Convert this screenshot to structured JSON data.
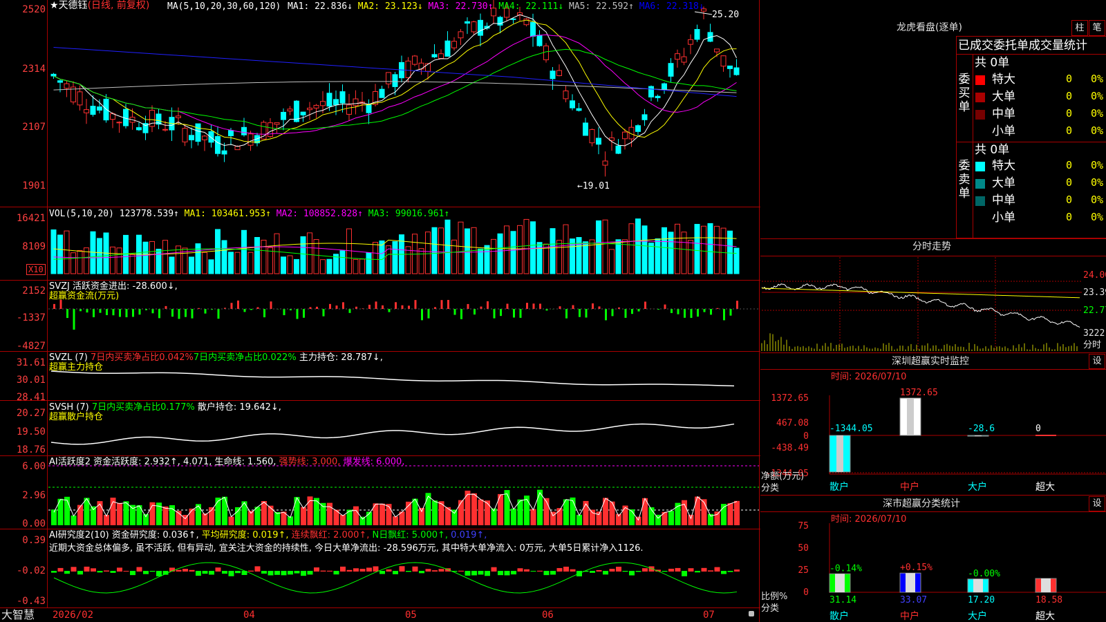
{
  "main": {
    "title_star": "★",
    "stock_name": "天德钰",
    "period": "(日线, 前复权)",
    "ma_params": "MA(5,10,20,30,60,120)",
    "ma_values": [
      {
        "label": "MA1: 22.836↓",
        "color": "#ffffff"
      },
      {
        "label": "MA2: 23.123↓",
        "color": "#ffff00"
      },
      {
        "label": "MA3: 22.730↑",
        "color": "#ff00ff"
      },
      {
        "label": "MA4: 22.111↓",
        "color": "#00ff00"
      },
      {
        "label": "MA5: 22.592↑",
        "color": "#c0c0c0"
      },
      {
        "label": "MA6: 22.318↓",
        "color": "#0000ff"
      }
    ],
    "y_axis": [
      "2520",
      "2314",
      "2107",
      "1901"
    ],
    "high_marker": "25.20",
    "low_marker": "←19.01"
  },
  "vol": {
    "label": "VOL(5,10,20)",
    "value": "123778.539↑",
    "ma1": "MA1: 103461.953↑",
    "ma2": "MA2: 108852.828↑",
    "ma3": "MA3: 99016.961↑",
    "y_axis": [
      "16421",
      "8109"
    ],
    "unit": "X10"
  },
  "svzj": {
    "label": "SVZJ",
    "text": "活跃资金进出: -28.600↓,",
    "subtitle": "超赢资金流(万元)",
    "y_axis": [
      "2152",
      "-1337",
      "-4827"
    ]
  },
  "svzl": {
    "label": "SVZL (7)",
    "a": "7日内买卖净占比0.042%",
    "b": "7日内买卖净占比0.022%",
    "c": "主力持仓: 28.787↓,",
    "subtitle": "超赢主力持仓",
    "y_axis": [
      "31.61",
      "30.01",
      "28.41"
    ]
  },
  "svsh": {
    "label": "SVSH (7)",
    "a": "7日内买卖净占比0.177%",
    "b": "散户持仓: 19.642↓,",
    "subtitle": "超赢散户持仓",
    "y_axis": [
      "20.27",
      "19.50",
      "18.76"
    ]
  },
  "ai1": {
    "label": "AI活跃度2",
    "a": "资金活跃度: 2.932↑,",
    "b": "4.071,",
    "c": "生命线: 1.560,",
    "d": "强势线: 3.000,",
    "e": "爆发线: 6.000,",
    "y_axis": [
      "6.00",
      "2.96",
      "0.00"
    ]
  },
  "ai2": {
    "label": "AI研究度2(10)",
    "a": "资金研究度: 0.036↑,",
    "b": "平均研究度: 0.019↑,",
    "c": "连续飘红: 2.000↑,",
    "d": "N日飘红: 5.000↑,",
    "e": "0.019↑,",
    "comment": "近期大资金总体偏多, 虽不活跃, 但有异动, 宜关注大资金的持续性, 今日大单净流出: -28.596万元, 其中特大单净流入: 0万元, 大单5日累计净入1126.",
    "y_axis": [
      "0.39",
      "-0.02",
      "-0.43"
    ]
  },
  "xaxis": {
    "brand": "大智慧",
    "labels": [
      "2026/02",
      "04",
      "05",
      "06",
      "07"
    ]
  },
  "right": {
    "longhu_title": "龙虎看盘(逐单)",
    "btn_bar": "柱",
    "btn_pen": "笔",
    "tabs": "已成交委托单成交量统计",
    "buy": {
      "side_label": "委买单",
      "total": "共 0单",
      "rows": [
        {
          "name": "特大",
          "color": "#ff0000",
          "v": "0",
          "p": "0%"
        },
        {
          "name": "大单",
          "color": "#aa0000",
          "v": "0",
          "p": "0%"
        },
        {
          "name": "中单",
          "color": "#770000",
          "v": "0",
          "p": "0%"
        },
        {
          "name": "小单",
          "color": "#000000",
          "v": "0",
          "p": "0%"
        }
      ]
    },
    "sell": {
      "side_label": "委卖单",
      "total": "共 0单",
      "rows": [
        {
          "name": "特大",
          "color": "#00ffff",
          "v": "0",
          "p": "0%"
        },
        {
          "name": "大单",
          "color": "#008888",
          "v": "0",
          "p": "0%"
        },
        {
          "name": "中单",
          "color": "#006666",
          "v": "0",
          "p": "0%"
        },
        {
          "name": "小单",
          "color": "#000000",
          "v": "0",
          "p": "0%"
        }
      ]
    },
    "intraday_title": "分时走势",
    "intraday_axis": [
      "24.00",
      "23.39",
      "22.77",
      "3222",
      "分时"
    ],
    "monitor": {
      "title": "深圳超赢实时监控",
      "btn": "设",
      "time": "时间: 2026/07/10",
      "y_axis": [
        "1372.65",
        "467.08",
        "0",
        "-438.49",
        "-1344.05"
      ],
      "unit": "净额(万元)",
      "cat_label": "分类",
      "categories": [
        "散户",
        "中户",
        "大户",
        "超大"
      ],
      "values": [
        "-1344.05",
        "1372.65",
        "-28.6",
        "0"
      ]
    },
    "stats": {
      "title": "深市超赢分类统计",
      "btn": "设",
      "time": "时间: 2026/07/10",
      "y_axis": [
        "75",
        "50",
        "25",
        "0"
      ],
      "unit": "比例%",
      "cat_label": "分类",
      "categories": [
        "散户",
        "中户",
        "大户",
        "超大"
      ],
      "changes": [
        "-0.14%",
        "+0.15%",
        "-0.00%",
        ""
      ],
      "values": [
        "31.14",
        "33.07",
        "17.20",
        "18.58"
      ]
    }
  }
}
